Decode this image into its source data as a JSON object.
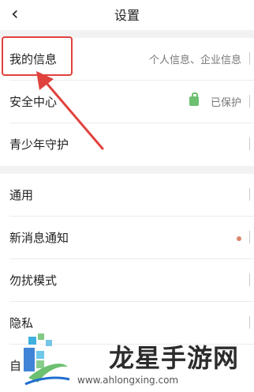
{
  "header": {
    "back_icon": "chevron-left-icon",
    "title": "设置"
  },
  "group1": [
    {
      "label": "我的信息",
      "value": "个人信息、企业信息"
    },
    {
      "label": "安全中心",
      "value": "已保护",
      "icon": "lock-icon"
    },
    {
      "label": "青少年守护"
    }
  ],
  "group2": [
    {
      "label": "通用"
    },
    {
      "label": "新消息通知"
    },
    {
      "label": "勿扰模式"
    },
    {
      "label": "隐私"
    },
    {
      "label": "自"
    }
  ],
  "highlight": {
    "color": "#e0423e"
  },
  "watermark": {
    "title": "龙星手游网",
    "url": "www.ahlongxing.com"
  },
  "colors": {
    "lock": "#6cc070",
    "notify_dot": "#d8856a"
  }
}
